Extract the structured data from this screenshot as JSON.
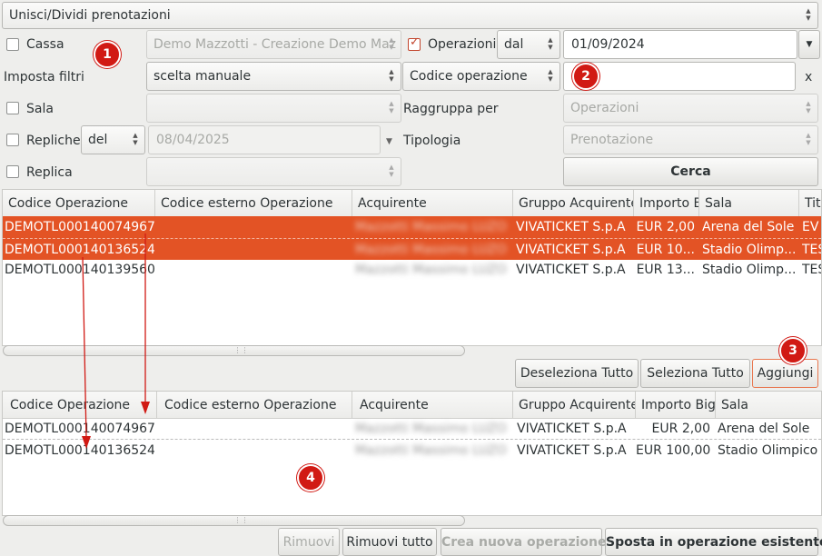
{
  "top_combo": "Unisci/Dividi prenotazioni",
  "filters": {
    "cassa_label": "Cassa",
    "cassa_value": "Demo Mazzotti - Creazione Demo Maz",
    "operazioni_label": "Operazioni",
    "operazioni_mode": "dal",
    "operazioni_date": "01/09/2024",
    "imposta_label": "Imposta filtri",
    "imposta_value": "scelta manuale",
    "codice_combo": "Codice operazione",
    "clear_label": "x",
    "sala_label": "Sala",
    "raggruppa_label": "Raggruppa per",
    "raggruppa_value": "Operazioni",
    "repliche_label": "Repliche",
    "repliche_mode": "del",
    "repliche_date": "08/04/2025",
    "tipologia_label": "Tipologia",
    "tipologia_value": "Prenotazione",
    "replica_label": "Replica",
    "cerca_label": "Cerca"
  },
  "top_table": {
    "columns": [
      "Codice Operazione",
      "Codice esterno Operazione",
      "Acquirente",
      "Gruppo Acquirente",
      "Importo B",
      "Sala",
      "Tit"
    ],
    "rows": [
      {
        "code": "DEMOTL000140074967",
        "ext": "",
        "buyer": "Mazzotti Massimo LUZO",
        "group": "VIVATICKET S.p.A",
        "amount": "EUR 2,00",
        "sala": "Arena del Sole",
        "tit": "EV",
        "selected": true
      },
      {
        "code": "DEMOTL000140136524",
        "ext": "",
        "buyer": "Mazzotti Massimo LUZO",
        "group": "VIVATICKET S.p.A",
        "amount": "EUR 10...",
        "sala": "Stadio Olimp...",
        "tit": "TES",
        "selected": true
      },
      {
        "code": "DEMOTL000140139560",
        "ext": "",
        "buyer": "Mazzotti Massimo LUZO",
        "group": "VIVATICKET S.p.A",
        "amount": "EUR 13...",
        "sala": "Stadio Olimp...",
        "tit": "TES",
        "selected": false
      }
    ]
  },
  "buttons_mid": {
    "deseleziona": "Deseleziona Tutto",
    "seleziona": "Seleziona Tutto",
    "aggiungi": "Aggiungi"
  },
  "bottom_table": {
    "columns": [
      "Codice Operazione",
      "Codice esterno Operazione",
      "Acquirente",
      "Gruppo Acquirente",
      "Importo Bigl",
      "Sala"
    ],
    "rows": [
      {
        "code": "DEMOTL000140074967",
        "ext": "",
        "buyer": "Mazzotti Massimo LUZO",
        "group": "VIVATICKET S.p.A",
        "amount": "EUR 2,00",
        "sala": "Arena del Sole"
      },
      {
        "code": "DEMOTL000140136524",
        "ext": "",
        "buyer": "Mazzotti Massimo LUZO",
        "group": "VIVATICKET S.p.A",
        "amount": "EUR 100,00",
        "sala": "Stadio Olimpico"
      }
    ]
  },
  "buttons_bottom": {
    "rimuovi": "Rimuovi",
    "rimuovi_tutto": "Rimuovi tutto",
    "crea": "Crea nuova operazione",
    "sposta": "Sposta in operazione esistente"
  },
  "badges": [
    "1",
    "2",
    "3",
    "4"
  ],
  "colors": {
    "selection": "#e35325",
    "badge": "#d11a14",
    "arrow": "#d11a14"
  }
}
